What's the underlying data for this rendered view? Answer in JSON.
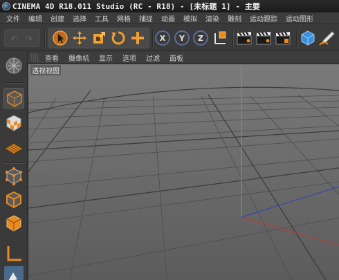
{
  "window": {
    "title": "CINEMA 4D R18.011 Studio (RC - R18) - [未标题 1] - 主要"
  },
  "menu": [
    "文件",
    "编辑",
    "创建",
    "选择",
    "工具",
    "网格",
    "捕捉",
    "动画",
    "模拟",
    "渲染",
    "雕刻",
    "运动跟踪",
    "运动图形"
  ],
  "toolbar": {
    "undo": "↶",
    "redo": "↷",
    "axis_x": "X",
    "axis_y": "Y",
    "axis_z": "Z"
  },
  "viewport_menu": [
    "查看",
    "摄像机",
    "显示",
    "选项",
    "过滤",
    "面板"
  ],
  "viewport": {
    "label": "透视视图"
  },
  "colors": {
    "accent_orange": "#e88a1e",
    "axis_x": "#c0392b",
    "axis_y": "#2ecc40",
    "axis_z": "#2d3fbf"
  }
}
